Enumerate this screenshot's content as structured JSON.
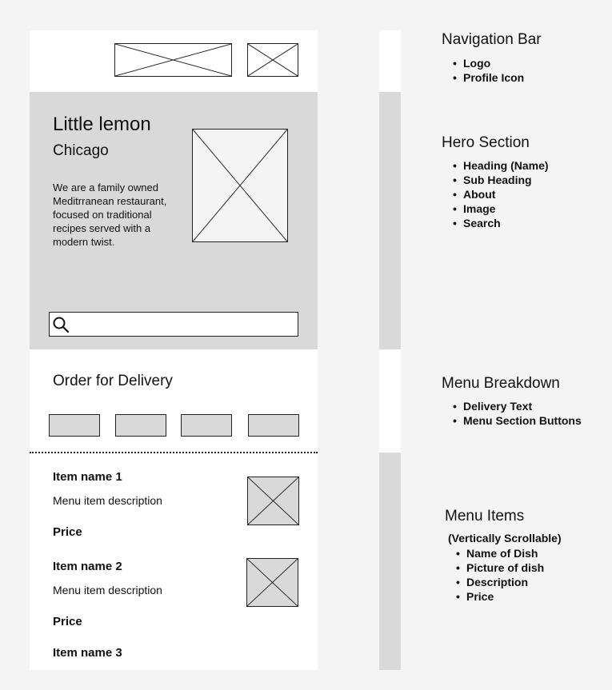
{
  "hero": {
    "title": "Little lemon",
    "subtitle": "Chicago",
    "about": "We are a family owned Meditrranean restaurant, focused on traditional recipes served with a modern twist."
  },
  "menu_breakdown": {
    "heading": "Order for Delivery"
  },
  "menu_items": [
    {
      "name": "Item name 1",
      "description": "Menu item description",
      "price": "Price"
    },
    {
      "name": "Item name 2",
      "description": "Menu item description",
      "price": "Price"
    },
    {
      "name": "Item name 3"
    }
  ],
  "annotations": {
    "nav": {
      "title": "Navigation Bar",
      "items": [
        "Logo",
        "Profile Icon"
      ]
    },
    "hero": {
      "title": "Hero Section",
      "items": [
        "Heading (Name)",
        "Sub Heading",
        "About",
        "Image",
        "Search"
      ]
    },
    "breakdown": {
      "title": "Menu Breakdown",
      "items": [
        "Delivery Text",
        "Menu Section Buttons"
      ]
    },
    "items": {
      "title": "Menu Items",
      "subtitle": "(Vertically Scrollable)",
      "items": [
        "Name of Dish",
        "Picture of dish",
        "Description",
        "Price"
      ]
    }
  },
  "colors": {
    "background": "#f4f4f4",
    "panel": "#ffffff",
    "placeholder_fill": "#d9d9d9",
    "stroke": "#222222"
  },
  "icons": [
    "search-icon",
    "placeholder-image-icon"
  ]
}
